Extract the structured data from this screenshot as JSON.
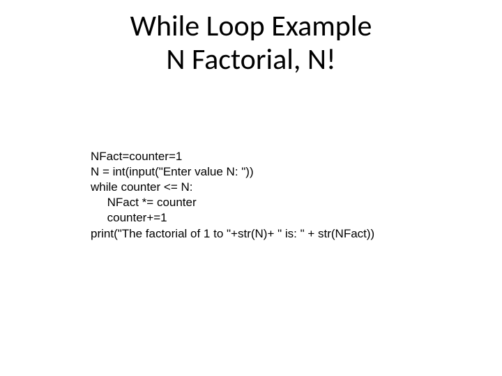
{
  "slide": {
    "title_line1": "While Loop Example",
    "title_line2": "N Factorial, N!",
    "code": {
      "line1": "NFact=counter=1",
      "line2": "N = int(input(\"Enter value N: \"))",
      "line3": "while counter <= N:",
      "line4": "     NFact *= counter",
      "line5": "     counter+=1",
      "line6": "print(\"The factorial of 1 to \"+str(N)+ \" is: \" + str(NFact))"
    }
  }
}
